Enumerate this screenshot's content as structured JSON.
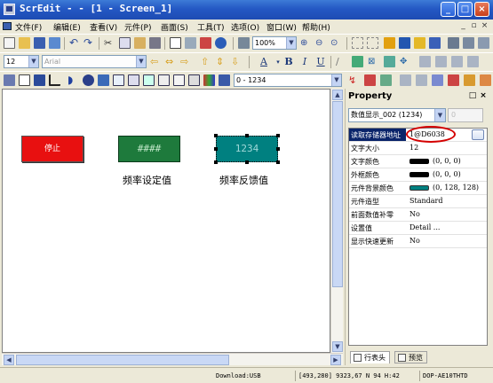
{
  "window": {
    "title": "ScrEdit - - [1 - Screen_1]",
    "minimize_icon": "minimize-icon",
    "maximize_icon": "maximize-icon",
    "close_icon": "close-icon"
  },
  "menu": {
    "items": [
      "文件(F)",
      "编辑(E)",
      "查看(V)",
      "元件(P)",
      "画面(S)",
      "工具(T)",
      "选项(O)",
      "窗口(W)",
      "帮助(H)"
    ],
    "mdi_controls": [
      "_",
      "▫",
      "×"
    ]
  },
  "toolbar": {
    "zoom": "100%",
    "font_size": "12",
    "font_name": "Arial",
    "bold": "B",
    "italic": "I",
    "underline": "U",
    "text_color": "A",
    "value_combo": "0 - 1234"
  },
  "canvas": {
    "stop_button_label": "停止",
    "freq_set_value": "####",
    "freq_feedback_value": "1234",
    "freq_set_caption": "频率设定值",
    "freq_feedback_caption": "频率反馈值",
    "colors": {
      "stop": "#e81010",
      "set_box": "#1e7a3c",
      "feedback_box": "#008080"
    }
  },
  "property_panel": {
    "title": "Property",
    "selected_object": "数值显示_002 (1234)",
    "spin_value": "0",
    "rows": [
      {
        "key": "读取存储器地址",
        "value": "1@D6038",
        "selected": true
      },
      {
        "key": "文字大小",
        "value": "12"
      },
      {
        "key": "文字颜色",
        "value": "(0, 0, 0)",
        "swatch": "#000000"
      },
      {
        "key": "外框颜色",
        "value": "(0, 0, 0)",
        "swatch": "#000000"
      },
      {
        "key": "元件背景颜色",
        "value": "(0, 128, 128)",
        "swatch": "#008080"
      },
      {
        "key": "元件造型",
        "value": "Standard"
      },
      {
        "key": "前面数值补零",
        "value": "No"
      },
      {
        "key": "设置值",
        "value": "Detail ..."
      },
      {
        "key": "显示快速更新",
        "value": "No"
      }
    ],
    "tabs": [
      "行表头",
      "预览"
    ]
  },
  "status": {
    "download": "Download:USB",
    "coords": "[493,280] 9323,67 N 94 H:42",
    "model": "DOP-AE10THTD"
  }
}
